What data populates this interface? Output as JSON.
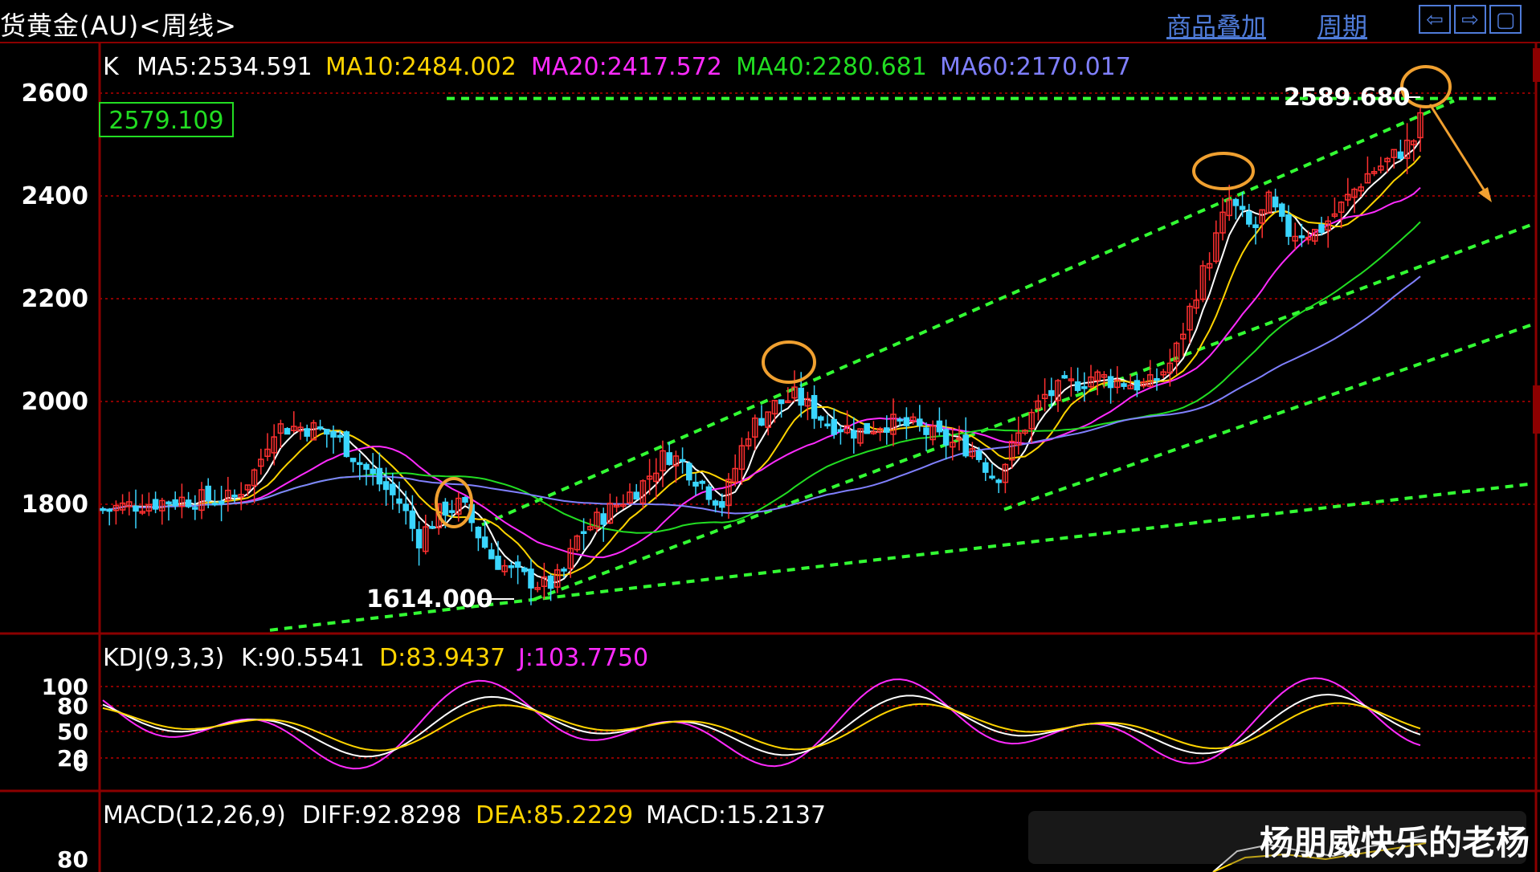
{
  "header": {
    "title": "货黄金(AU)<周线>",
    "links": [
      "商品叠加",
      "周期"
    ],
    "nav_buttons": [
      "⇦",
      "⇨",
      "▢"
    ]
  },
  "main_panel": {
    "label_k": "K",
    "ma_labels": [
      {
        "text": "MA5:2534.591",
        "color": "#ffffff"
      },
      {
        "text": "MA10:2484.002",
        "color": "#ffd400"
      },
      {
        "text": "MA20:2417.572",
        "color": "#ff2bff"
      },
      {
        "text": "MA40:2280.681",
        "color": "#22dd22"
      },
      {
        "text": "MA60:2170.017",
        "color": "#8080ff"
      }
    ],
    "current_price_box": "2579.109",
    "high_label": "2589.680",
    "low_label": "1614.000",
    "y_ticks": [
      "2600",
      "2400",
      "2200",
      "2000",
      "1800"
    ]
  },
  "kdj_panel": {
    "title": "KDJ(9,3,3)",
    "k_label": "K:90.5541",
    "d_label": "D:83.9437",
    "j_label": "J:103.7750",
    "y_ticks": [
      "100",
      "80",
      "50",
      "20",
      "0"
    ]
  },
  "macd_panel": {
    "title": "MACD(12,26,9)",
    "diff_label": "DIFF:92.8298",
    "dea_label": "DEA:85.2229",
    "macd_label": "MACD:15.2137",
    "y_ticks": [
      "80"
    ]
  },
  "watermark": {
    "text": "杨朋威快乐的老杨"
  },
  "colors": {
    "up": "#ff3030",
    "down": "#3ad6ff",
    "trendline": "#33ff33",
    "circle": "#f0a030",
    "grid": "#8b0000"
  },
  "chart_data": {
    "type": "candlestick",
    "ylim": [
      1560,
      2660
    ],
    "latest": {
      "ma5": 2534.591,
      "ma10": 2484.002,
      "ma20": 2417.572,
      "ma40": 2280.681,
      "ma60": 2170.017
    },
    "high": 2589.68,
    "low": 1614.0,
    "last_close": 2579.109,
    "kdj": {
      "k": 90.5541,
      "d": 83.9437,
      "j": 103.775
    },
    "macd": {
      "diff": 92.8298,
      "dea": 85.2229,
      "macd": 15.2137
    }
  }
}
